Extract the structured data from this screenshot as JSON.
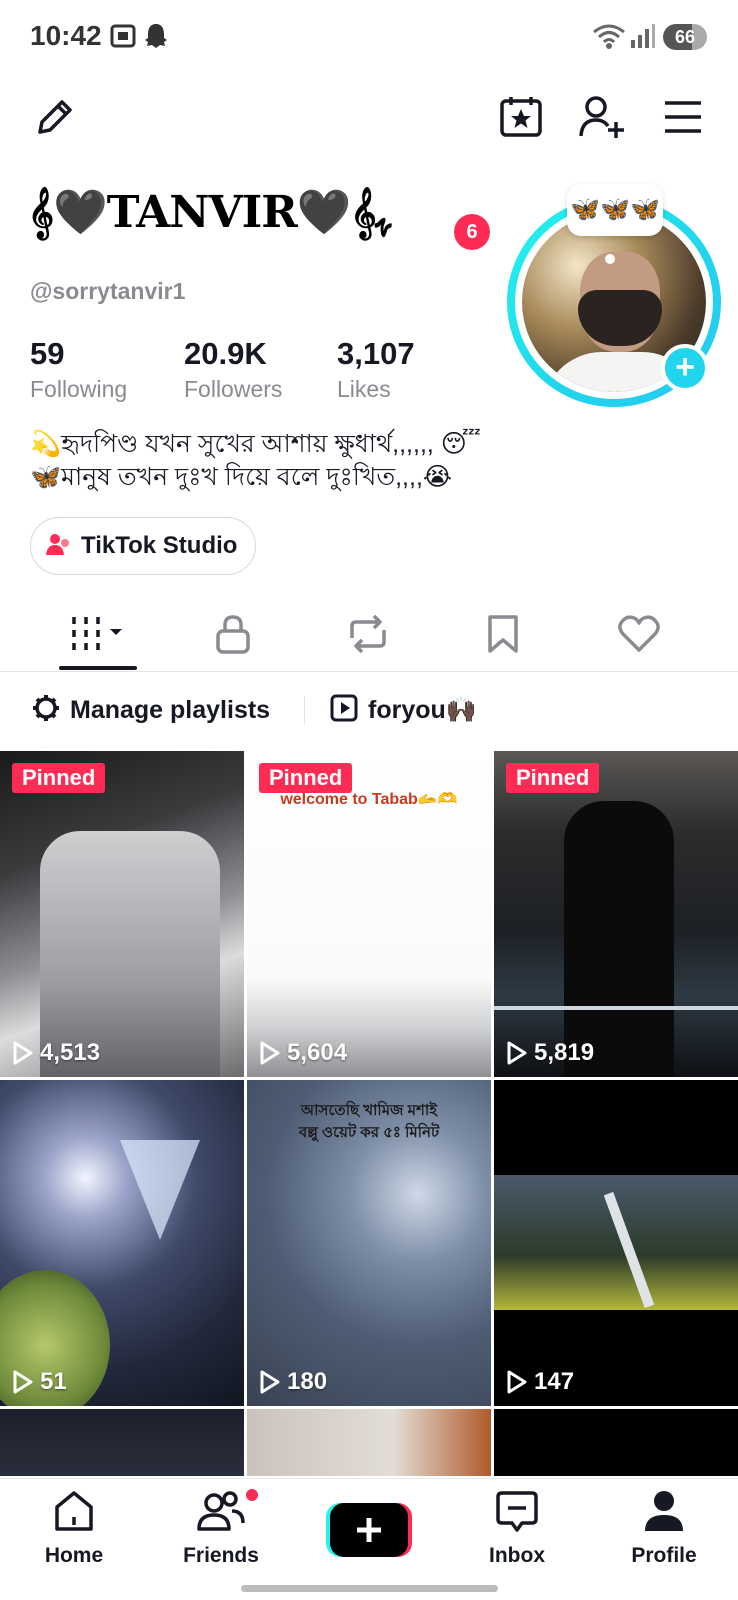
{
  "status_bar": {
    "time": "10:42",
    "battery": "66",
    "icons": [
      "screenshot-icon",
      "snapchat-ghost-icon",
      "wifi-icon",
      "signal-icon"
    ]
  },
  "top_bar": {
    "icons": [
      "edit-pencil-icon",
      "calendar-star-icon",
      "add-friend-icon",
      "menu-icon"
    ]
  },
  "profile": {
    "display_name": "𝄞🖤TANVIR🖤𝄞ﮩ",
    "name_badge": "6",
    "username": "@sorrytanvir1",
    "note": "🦋🦋🦋",
    "stats": [
      {
        "value": "59",
        "label": "Following"
      },
      {
        "value": "20.9K",
        "label": "Followers"
      },
      {
        "value": "3,107",
        "label": "Likes"
      }
    ],
    "bio": [
      "💫হৃদপিণ্ড যখন সুখের আশায় ক্ষুধার্থ,,,,,, 😴",
      "🦋মানুষ তখন দুঃখ দিয়ে  বলে দুঃখিত,,,,😭"
    ],
    "studio_label": "TikTok Studio"
  },
  "tabs": [
    "videos-grid-icon",
    "lock-icon",
    "repost-icon",
    "bookmark-icon",
    "heart-icon"
  ],
  "playlists": {
    "manage_label": "Manage playlists",
    "playlist_name": "foryou🙌🏿"
  },
  "videos": [
    {
      "views": "4,513",
      "pinned": "Pinned",
      "overlay": ""
    },
    {
      "views": "5,604",
      "pinned": "Pinned",
      "overlay": "welcome to Tabab🫴🫶"
    },
    {
      "views": "5,819",
      "pinned": "Pinned",
      "overlay": ""
    },
    {
      "views": "51",
      "pinned": "",
      "overlay": ""
    },
    {
      "views": "180",
      "pinned": "",
      "overlay": "আসতেছি খামিজ মশাই\nবল্লু ওয়েট কর ৫ঃ মিনিট"
    },
    {
      "views": "147",
      "pinned": "",
      "overlay": ""
    }
  ],
  "bottom_nav": [
    {
      "label": "Home",
      "icon": "home-icon"
    },
    {
      "label": "Friends",
      "icon": "friends-icon"
    },
    {
      "label": "",
      "icon": "create-plus-icon"
    },
    {
      "label": "Inbox",
      "icon": "inbox-icon"
    },
    {
      "label": "Profile",
      "icon": "profile-icon"
    }
  ],
  "colors": {
    "accent": "#fe2c55",
    "cyan": "#25f4ee",
    "text": "#161823",
    "muted": "#8a8b91"
  }
}
